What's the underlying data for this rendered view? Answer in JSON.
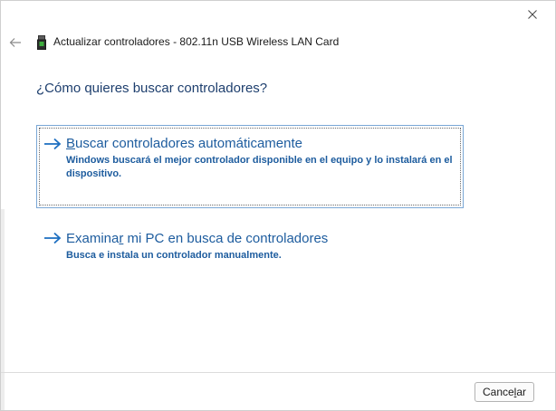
{
  "window": {
    "title": "Actualizar controladores - 802.11n USB Wireless LAN Card",
    "close_icon": "close-icon",
    "back_icon": "back-arrow-icon",
    "device_icon": "network-adapter-icon"
  },
  "main": {
    "question": "¿Cómo quieres buscar controladores?",
    "options": [
      {
        "title_accel": "B",
        "title_rest": "uscar controladores automáticamente",
        "description": "Windows buscará el mejor controlador disponible en el equipo y lo instalará en el dispositivo.",
        "icon": "arrow-right-icon"
      },
      {
        "title_pre": "Examina",
        "title_accel": "r",
        "title_rest": " mi PC en busca de controladores",
        "description": "Busca e instala un controlador manualmente.",
        "icon": "arrow-right-icon"
      }
    ]
  },
  "footer": {
    "cancel_pre": "Cance",
    "cancel_accel": "l",
    "cancel_rest": "ar"
  },
  "colors": {
    "link": "#1d5c9e",
    "heading": "#1e3f6e",
    "focus_border": "#7aa7d6"
  }
}
